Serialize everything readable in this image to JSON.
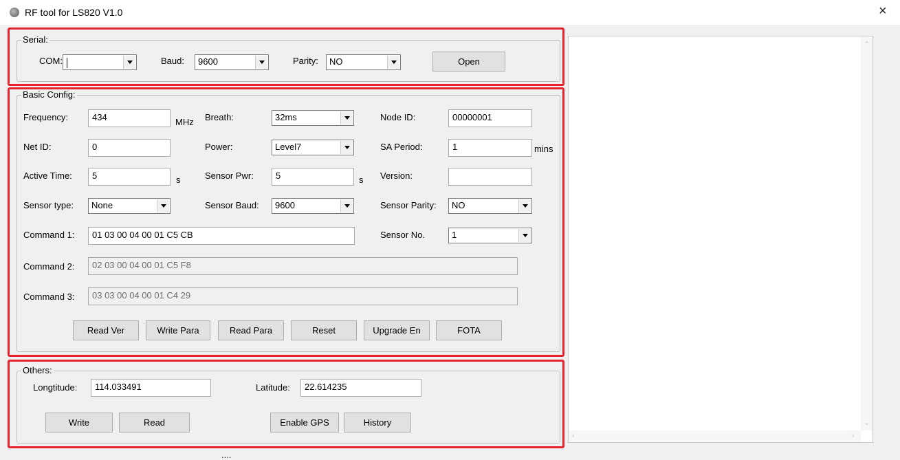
{
  "window": {
    "title": "RF tool for LS820   V1.0",
    "close_glyph": "×",
    "status_grip": "...."
  },
  "serial": {
    "legend": "Serial:",
    "com_label": "COM:",
    "com_value": "",
    "baud_label": "Baud:",
    "baud_value": "9600",
    "parity_label": "Parity:",
    "parity_value": "NO",
    "open_button": "Open"
  },
  "basic": {
    "legend": "Basic Config:",
    "frequency_label": "Frequency:",
    "frequency_value": "434",
    "frequency_unit": "MHz",
    "breath_label": "Breath:",
    "breath_value": "32ms",
    "node_id_label": "Node ID:",
    "node_id_value": "00000001",
    "net_id_label": "Net ID:",
    "net_id_value": "0",
    "power_label": "Power:",
    "power_value": "Level7",
    "sa_period_label": "SA Period:",
    "sa_period_value": "1",
    "sa_period_unit": "mins",
    "active_time_label": "Active Time:",
    "active_time_value": "5",
    "active_time_unit": "s",
    "sensor_pwr_label": "Sensor Pwr:",
    "sensor_pwr_value": "5",
    "sensor_pwr_unit": "s",
    "version_label": "Version:",
    "version_value": "",
    "sensor_type_label": "Sensor type:",
    "sensor_type_value": "None",
    "sensor_baud_label": "Sensor Baud:",
    "sensor_baud_value": "9600",
    "sensor_parity_label": "Sensor Parity:",
    "sensor_parity_value": "NO",
    "command1_label": "Command 1:",
    "command1_value": "01 03 00 04 00 01 C5 CB",
    "sensor_no_label": "Sensor No.",
    "sensor_no_value": "1",
    "command2_label": "Command 2:",
    "command2_value": "02 03 00 04 00 01 C5 F8",
    "command3_label": "Command 3:",
    "command3_value": "03 03 00 04 00 01 C4 29",
    "buttons": {
      "read_ver": "Read Ver",
      "write_para": "Write Para",
      "read_para": "Read Para",
      "reset": "Reset",
      "upgrade_en": "Upgrade En",
      "fota": "FOTA"
    }
  },
  "others": {
    "legend": "Others:",
    "longitude_label": "Longtitude:",
    "longitude_value": "114.033491",
    "latitude_label": "Latitude:",
    "latitude_value": "22.614235",
    "buttons": {
      "write": "Write",
      "read": "Read",
      "enable_gps": "Enable GPS",
      "history": "History"
    }
  },
  "log": {
    "content": ""
  },
  "colors": {
    "highlight_frame": "#e8232d",
    "window_bg": "#f0f0f0",
    "button_bg": "#e1e1e1"
  },
  "icons": [
    "app-icon",
    "close-icon",
    "dropdown-arrow-icon",
    "scroll-up-icon",
    "scroll-down-icon",
    "scroll-left-icon",
    "scroll-right-icon"
  ]
}
